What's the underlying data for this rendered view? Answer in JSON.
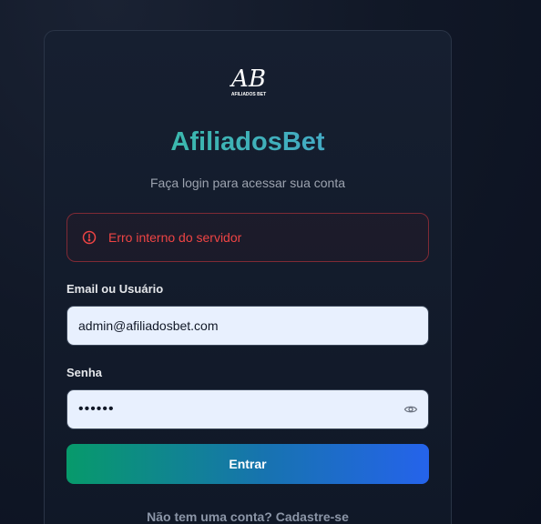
{
  "brand": {
    "logo_text_top": "AB",
    "logo_text_bottom": "AFILIADOS BET",
    "name": "AfiliadosBet",
    "subtitle": "Faça login para acessar sua conta",
    "gradient_start": "#34c39a",
    "gradient_end": "#4a9fd6"
  },
  "error": {
    "icon": "alert-circle-icon",
    "message": "Erro interno do servidor",
    "color": "#ef4444"
  },
  "form": {
    "email_label": "Email ou Usuário",
    "email_value": "admin@afiliadosbet.com",
    "password_label": "Senha",
    "password_value": "••••••",
    "password_toggle_icon": "eye-icon",
    "submit_label": "Entrar"
  },
  "footer": {
    "signup_prompt": "Não tem uma conta?",
    "signup_link": "Cadastre-se"
  }
}
